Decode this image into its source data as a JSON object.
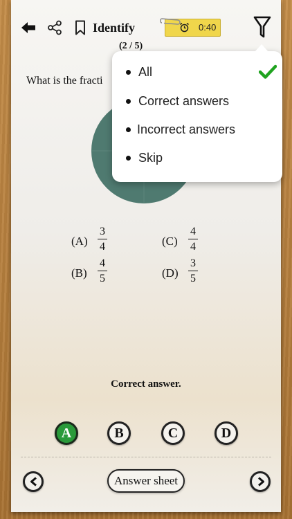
{
  "header": {
    "title": "Identify",
    "counter": "(2 / 5)",
    "timer": "0:40",
    "icons": [
      "back-arrow-icon",
      "share-icon",
      "bookmark-icon",
      "alarm-clock-icon",
      "filter-icon"
    ]
  },
  "question": {
    "text": "What is the fracti"
  },
  "options": [
    {
      "letter": "(A)",
      "numerator": "3",
      "denominator": "4"
    },
    {
      "letter": "(B)",
      "numerator": "4",
      "denominator": "5"
    },
    {
      "letter": "(C)",
      "numerator": "4",
      "denominator": "4"
    },
    {
      "letter": "(D)",
      "numerator": "3",
      "denominator": "5"
    }
  ],
  "feedback": "Correct answer.",
  "choices": [
    {
      "label": "A",
      "selected": true
    },
    {
      "label": "B",
      "selected": false
    },
    {
      "label": "C",
      "selected": false
    },
    {
      "label": "D",
      "selected": false
    }
  ],
  "footer": {
    "answer_sheet_label": "Answer sheet",
    "icons": [
      "prev-icon",
      "next-icon"
    ]
  },
  "filter_menu": {
    "items": [
      {
        "label": "All",
        "checked": true
      },
      {
        "label": "Correct answers",
        "checked": false
      },
      {
        "label": "Incorrect answers",
        "checked": false
      },
      {
        "label": "Skip",
        "checked": false
      }
    ]
  },
  "colors": {
    "pie": "#4f7a70",
    "selected_choice": "#2a9a3a",
    "check": "#1fa31f",
    "timer_bg": "#f0d64b",
    "wood": "#b7813f"
  }
}
